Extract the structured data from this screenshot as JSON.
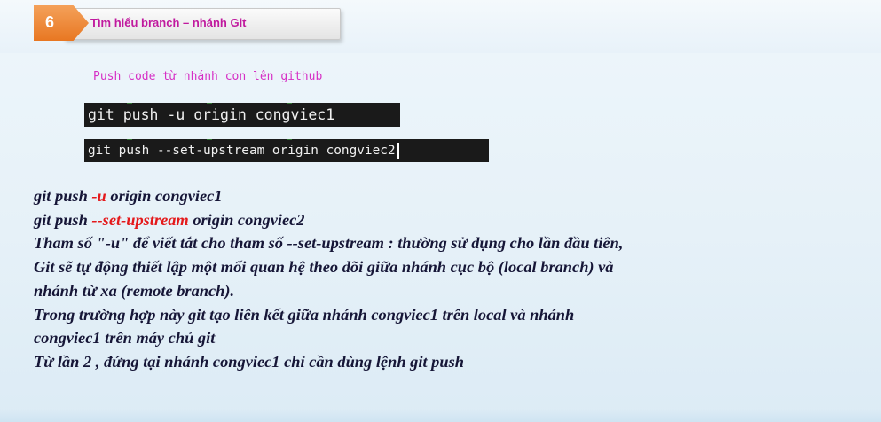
{
  "header": {
    "number": "6",
    "title": "Tìm hiểu branch – nhánh Git"
  },
  "code": {
    "caption": "Push code từ nhánh con lên github",
    "line1": "git push -u origin congviec1",
    "line2": "git push --set-upstream  origin congviec2"
  },
  "body": {
    "cmd1": {
      "prefix": "git push ",
      "flag": "-u",
      "suffix": " origin congviec1"
    },
    "cmd2": {
      "prefix": "git push ",
      "flag": "--set-upstream",
      "suffix": "  origin congviec2"
    },
    "para1_l1": "Tham số \"-u\" để viết tắt cho tham số --set-upstream : thường sử dụng cho lần đầu tiên,",
    "para1_l2": "Git sẽ tự động thiết lập một mối quan hệ theo dõi giữa nhánh cục bộ (local branch) và",
    "para1_l3": "nhánh từ xa (remote branch).",
    "para2_l1": "Trong trường hợp này git tạo liên kết giữa nhánh congviec1 trên local và nhánh",
    "para2_l2": "congviec1 trên máy chủ git",
    "para3": "Từ lần 2 , đứng tại nhánh congviec1 chỉ cần dùng lệnh git push"
  },
  "colors": {
    "accent_orange": "#e87722",
    "title_magenta": "#c0199e",
    "flag_red": "#e4191b",
    "body_text": "#161637",
    "code_bg": "#1a1a1a"
  }
}
